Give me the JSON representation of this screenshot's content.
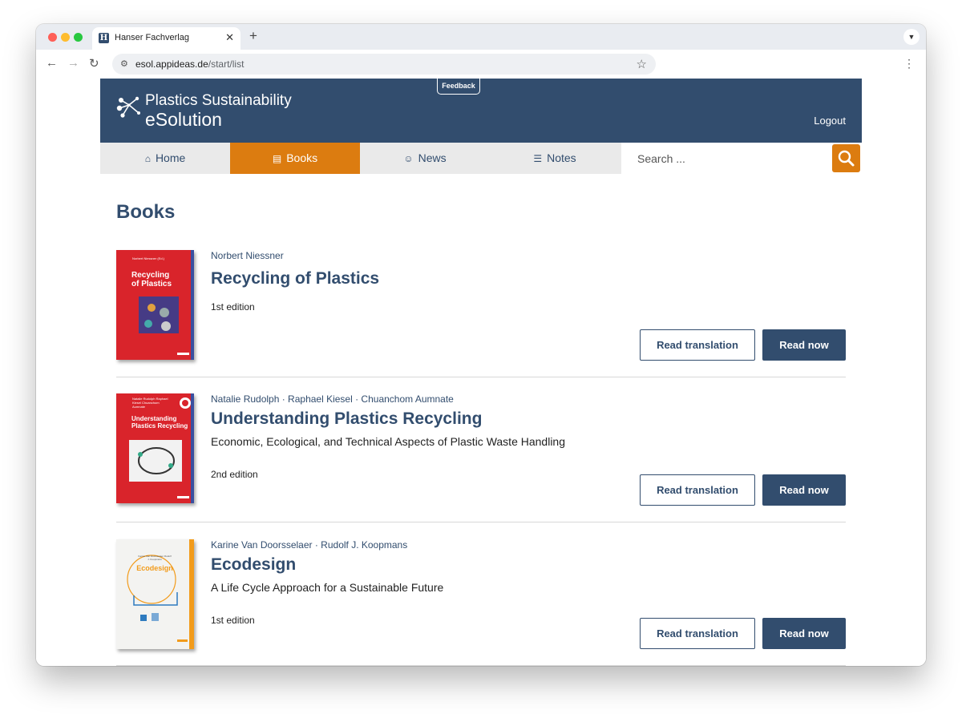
{
  "browser": {
    "tab_title": "Hanser Fachverlag",
    "favicon_letter": "H",
    "new_tab_label": "+",
    "url_host": "esol.appideas.de",
    "url_path": "/start/list"
  },
  "header": {
    "logo_line1": "Plastics Sustainability",
    "logo_line2": "eSolution",
    "feedback_label": "Feedback",
    "logout_label": "Logout",
    "brand_color": "#324d6e",
    "accent_color": "#dc7c10"
  },
  "nav": {
    "items": [
      {
        "label": "Home",
        "icon": "home-icon",
        "active": false
      },
      {
        "label": "Books",
        "icon": "book-icon",
        "active": true
      },
      {
        "label": "News",
        "icon": "news-icon",
        "active": false
      },
      {
        "label": "Notes",
        "icon": "notes-icon",
        "active": false
      }
    ],
    "search_placeholder": "Search ..."
  },
  "main": {
    "title": "Books",
    "books": [
      {
        "authors": "Norbert Niessner",
        "title": "Recycling of Plastics",
        "subtitle": "",
        "edition": "1st edition",
        "translate_label": "Read translation",
        "read_label": "Read now",
        "cover_title": "Recycling of Plastics",
        "cover_author": "Norbert Niessner (Ed.)",
        "cover_color": "#d9242b"
      },
      {
        "authors": "Natalie Rudolph · Raphael Kiesel · Chuanchom Aumnate",
        "title": "Understanding Plastics Recycling",
        "subtitle": "Economic, Ecological, and Technical Aspects of Plastic Waste Handling",
        "edition": "2nd edition",
        "translate_label": "Read translation",
        "read_label": "Read now",
        "cover_title": "Understanding Plastics Recycling",
        "cover_author": "Natalie Rudolph Raphael Kiesel Chuanchom Aumnate",
        "cover_color": "#d9242b"
      },
      {
        "authors": "Karine Van Doorsselaer · Rudolf J. Koopmans",
        "title": "Ecodesign",
        "subtitle": "A Life Cycle Approach for a Sustainable Future",
        "edition": "1st edition",
        "translate_label": "Read translation",
        "read_label": "Read now",
        "cover_title": "Ecodesign",
        "cover_author": "Karine Van Doorsselaer Rudolf J. Koopmans",
        "cover_color": "#f3f3f1"
      }
    ]
  }
}
